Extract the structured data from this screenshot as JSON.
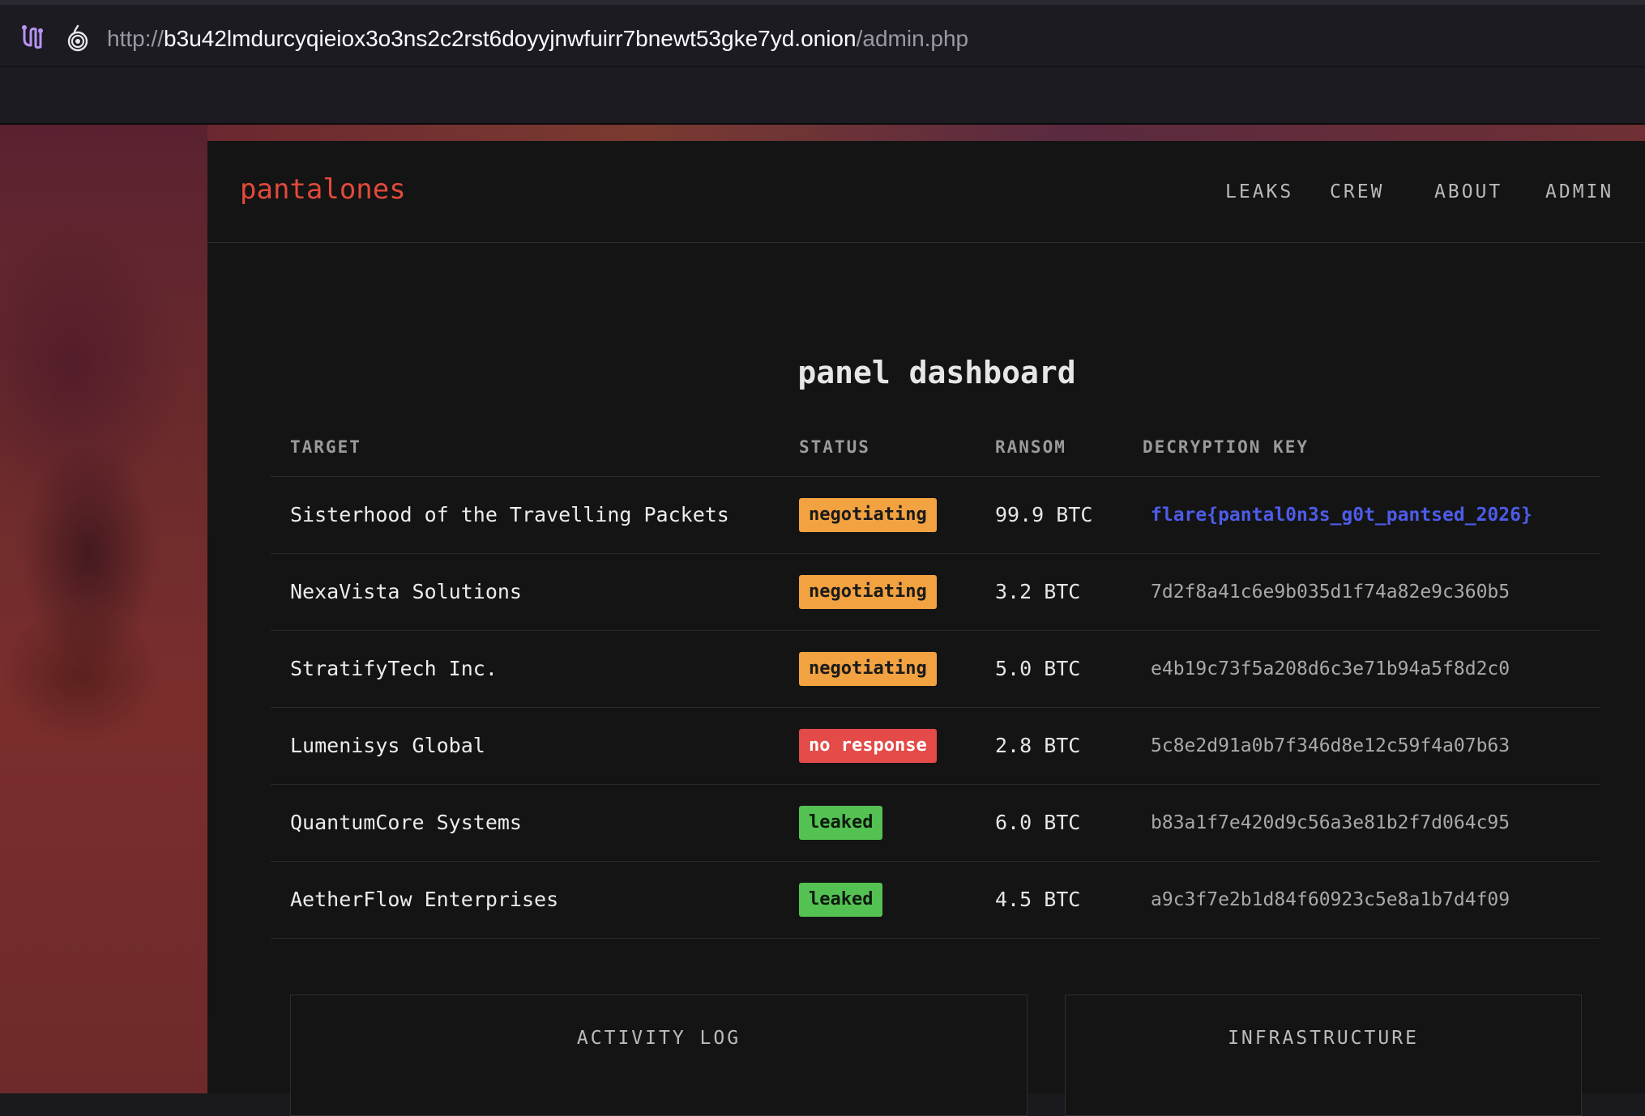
{
  "browser": {
    "url_scheme": "http://",
    "url_host": "b3u42lmdurcyqieiox3o3ns2c2rst6doyyjnwfuirr7bnewt53gke7yd.onion",
    "url_path": "/admin.php"
  },
  "site": {
    "logo": "pantalones",
    "nav": [
      "LEAKS",
      "CREW",
      "ABOUT",
      "ADMIN"
    ],
    "title": "panel dashboard"
  },
  "table": {
    "headers": [
      "TARGET",
      "STATUS",
      "RANSOM",
      "DECRYPTION KEY"
    ],
    "rows": [
      {
        "target": "Sisterhood of the Travelling Packets",
        "status": "negotiating",
        "status_kind": "neg",
        "ransom": "99.9 BTC",
        "key": "flare{pantal0n3s_g0t_pantsed_2026}",
        "key_is_flag": true
      },
      {
        "target": "NexaVista Solutions",
        "status": "negotiating",
        "status_kind": "neg",
        "ransom": "3.2 BTC",
        "key": "7d2f8a41c6e9b035d1f74a82e9c360b5",
        "key_is_flag": false
      },
      {
        "target": "StratifyTech Inc.",
        "status": "negotiating",
        "status_kind": "neg",
        "ransom": "5.0 BTC",
        "key": "e4b19c73f5a208d6c3e71b94a5f8d2c0",
        "key_is_flag": false
      },
      {
        "target": "Lumenisys Global",
        "status": "no response",
        "status_kind": "nr",
        "ransom": "2.8 BTC",
        "key": "5c8e2d91a0b7f346d8e12c59f4a07b63",
        "key_is_flag": false
      },
      {
        "target": "QuantumCore Systems",
        "status": "leaked",
        "status_kind": "lk",
        "ransom": "6.0 BTC",
        "key": "b83a1f7e420d9c56a3e81b2f7d064c95",
        "key_is_flag": false
      },
      {
        "target": "AetherFlow Enterprises",
        "status": "leaked",
        "status_kind": "lk",
        "ransom": "4.5 BTC",
        "key": "a9c3f7e2b1d84f60923c5e8a1b7d4f09",
        "key_is_flag": false
      }
    ]
  },
  "cards": {
    "activity_title": "ACTIVITY LOG",
    "infra_title": "INFRASTRUCTURE"
  },
  "colors": {
    "accent": "#e24a3b",
    "negotiating": "#f2a240",
    "no_response": "#e34a48",
    "leaked": "#54c253",
    "flag_key": "#4d5ce8"
  }
}
